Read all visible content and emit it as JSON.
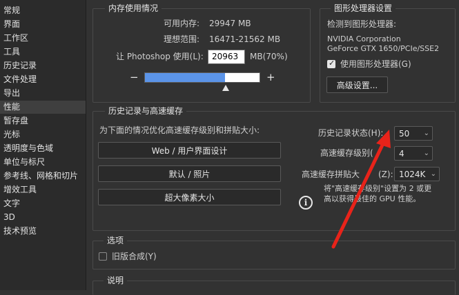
{
  "sidebar": {
    "items": [
      {
        "label": "常规"
      },
      {
        "label": "界面"
      },
      {
        "label": "工作区"
      },
      {
        "label": "工具"
      },
      {
        "label": "历史记录"
      },
      {
        "label": "文件处理"
      },
      {
        "label": "导出"
      },
      {
        "label": "性能"
      },
      {
        "label": "暂存盘"
      },
      {
        "label": "光标"
      },
      {
        "label": "透明度与色域"
      },
      {
        "label": "单位与标尺"
      },
      {
        "label": "参考线、网格和切片"
      },
      {
        "label": "增效工具"
      },
      {
        "label": "文字"
      },
      {
        "label": "3D"
      },
      {
        "label": "技术预览"
      }
    ],
    "active_index": 7
  },
  "memory": {
    "title": "内存使用情况",
    "available_label": "可用内存:",
    "available_value": "29947 MB",
    "ideal_label": "理想范围:",
    "ideal_value": "16471-21562 MB",
    "use_label": "让 Photoshop 使用(L):",
    "use_value": "20963",
    "use_unit": "MB(70%)",
    "minus": "−",
    "plus": "+",
    "slider_fraction": 0.7
  },
  "gpu": {
    "title": "图形处理器设置",
    "detected_label": "检测到图形处理器:",
    "vendor": "NVIDIA Corporation",
    "model": "GeForce GTX 1650/PCIe/SSE2",
    "use_gpu_label": "使用图形处理器(G)",
    "use_gpu_checked": true,
    "advanced_button": "高级设置..."
  },
  "history_cache": {
    "title": "历史记录与高速缓存",
    "optimize_label": "为下面的情况优化高速缓存级别和拼贴大小:",
    "btn_web": "Web / 用户界面设计",
    "btn_default": "默认 / 照片",
    "btn_huge": "超大像素大小",
    "history_states_label": "历史记录状态(H):",
    "history_states_value": "50",
    "cache_levels_label": "高速缓存级别(",
    "cache_levels_value": "4",
    "tile_size_label": "高速缓存拼贴大",
    "tile_size_suffix": "(Z):",
    "tile_size_value": "1024K",
    "info_line1": "将\"高速缓存级别\"设置为 2 或更",
    "info_line2": "高以获得最佳的 GPU 性能。"
  },
  "options": {
    "title": "选项",
    "legacy_composite_label": "旧版合成(Y)",
    "legacy_composite_checked": false
  },
  "description": {
    "title": "说明"
  },
  "annotation": {
    "color": "#e8231a"
  }
}
